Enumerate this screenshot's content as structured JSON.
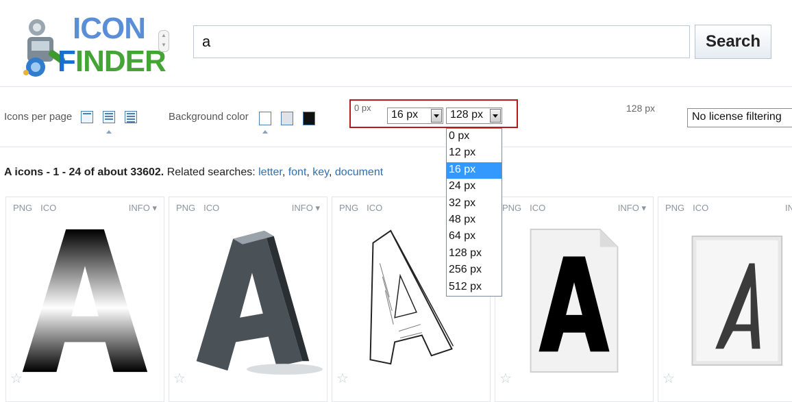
{
  "logo": {
    "line1": "ICON",
    "line2_first": "F",
    "line2_rest": "INDER",
    "mascot": "robot-mascot-icon"
  },
  "search": {
    "value": "a",
    "button_label": "Search"
  },
  "options": {
    "icons_per_page_label": "Icons per page",
    "background_color_label": "Background color",
    "min_size_label": "0 px",
    "max_size_label": "128 px",
    "min_size_value": "16 px",
    "max_size_value": "128 px",
    "license_value": "No license filtering"
  },
  "size_options": [
    "0 px",
    "12 px",
    "16 px",
    "24 px",
    "32 px",
    "48 px",
    "64 px",
    "128 px",
    "256 px",
    "512 px"
  ],
  "selected_size": "16 px",
  "results": {
    "summary_bold": "A icons - 1 - 24 of about 33602.",
    "related_label": "Related searches:",
    "related": [
      "letter",
      "font",
      "key",
      "document"
    ]
  },
  "cards": [
    {
      "png": "PNG",
      "ico": "ICO",
      "info": "INFO ▾",
      "icon": "letter-a-gradient-icon"
    },
    {
      "png": "PNG",
      "ico": "ICO",
      "info": "INFO ▾",
      "icon": "letter-a-3d-metal-icon"
    },
    {
      "png": "PNG",
      "ico": "ICO",
      "info": "",
      "icon": "letter-a-sketch-icon"
    },
    {
      "png": "PNG",
      "ico": "ICO",
      "info": "INFO ▾",
      "icon": "letter-a-document-icon"
    },
    {
      "png": "PNG",
      "ico": "ICO",
      "info": "IN",
      "icon": "letter-a-font-file-icon"
    }
  ],
  "colors": {
    "accent_blue": "#3399ff",
    "highlight_red": "#b31b1b",
    "link_blue": "#2f6fb0"
  }
}
